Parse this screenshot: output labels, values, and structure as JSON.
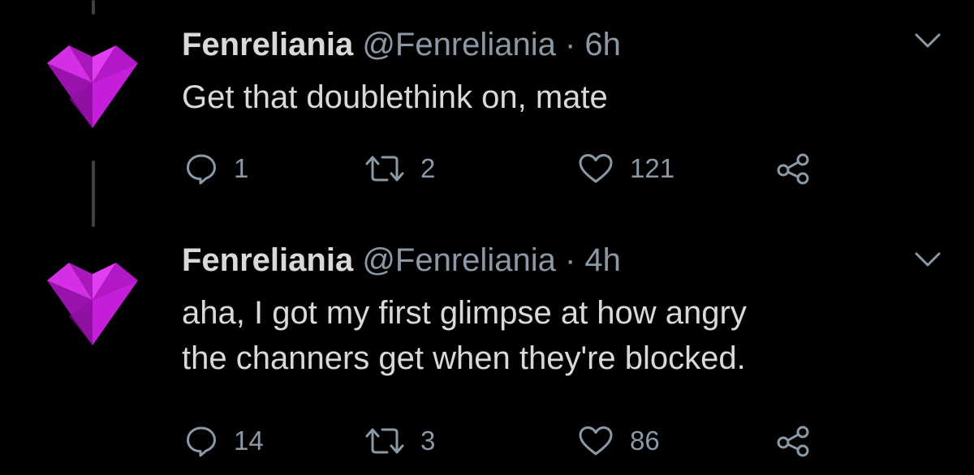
{
  "colors": {
    "background": "#000000",
    "primary_text": "#d9d9d9",
    "secondary_text": "#8b98a5",
    "thread_line": "#3d4145",
    "avatar_heart": "#b515c8"
  },
  "tweets": [
    {
      "avatar_icon": "heart-avatar-icon",
      "name": "Fenreliania",
      "handle": "@Fenreliania",
      "separator": "·",
      "time": "6h",
      "text_lines": [
        "Get that doublethink on, mate"
      ],
      "actions": {
        "replies": "1",
        "retweets": "2",
        "likes": "121",
        "reply_icon": "reply-bubble-icon",
        "retweet_icon": "retweet-icon",
        "like_icon": "heart-outline-icon",
        "share_icon": "share-icon"
      }
    },
    {
      "avatar_icon": "heart-avatar-icon",
      "name": "Fenreliania",
      "handle": "@Fenreliania",
      "separator": "·",
      "time": "4h",
      "text_lines": [
        "aha, I got my first glimpse at how angry",
        "the channers get when they're blocked."
      ],
      "actions": {
        "replies": "14",
        "retweets": "3",
        "likes": "86",
        "reply_icon": "reply-bubble-icon",
        "retweet_icon": "retweet-icon",
        "like_icon": "heart-outline-icon",
        "share_icon": "share-icon"
      }
    }
  ]
}
